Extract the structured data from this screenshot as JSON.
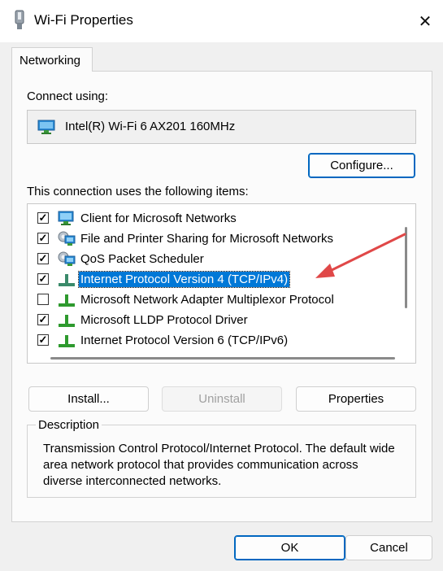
{
  "window": {
    "title": "Wi-Fi Properties",
    "close_glyph": "✕"
  },
  "tabs": [
    {
      "label": "Networking",
      "active": true
    }
  ],
  "connect_using": {
    "label": "Connect using:",
    "adapter": "Intel(R) Wi-Fi 6 AX201 160MHz",
    "configure_label": "Configure..."
  },
  "items_section": {
    "label": "This connection uses the following items:",
    "items": [
      {
        "label": "Client for Microsoft Networks",
        "checked": true,
        "icon": "network-client-icon",
        "selected": false
      },
      {
        "label": "File and Printer Sharing for Microsoft Networks",
        "checked": true,
        "icon": "service-icon",
        "selected": false
      },
      {
        "label": "QoS Packet Scheduler",
        "checked": true,
        "icon": "service-icon",
        "selected": false
      },
      {
        "label": "Internet Protocol Version 4 (TCP/IPv4)",
        "checked": true,
        "icon": "protocol-icon",
        "selected": true
      },
      {
        "label": "Microsoft Network Adapter Multiplexor Protocol",
        "checked": false,
        "icon": "protocol-icon",
        "selected": false
      },
      {
        "label": "Microsoft LLDP Protocol Driver",
        "checked": true,
        "icon": "protocol-icon",
        "selected": false
      },
      {
        "label": "Internet Protocol Version 6 (TCP/IPv6)",
        "checked": true,
        "icon": "protocol-icon",
        "selected": false
      }
    ]
  },
  "actions": {
    "install_label": "Install...",
    "uninstall_label": "Uninstall",
    "properties_label": "Properties"
  },
  "description": {
    "title": "Description",
    "text": "Transmission Control Protocol/Internet Protocol. The default wide area network protocol that provides communication across diverse interconnected networks."
  },
  "footer": {
    "ok_label": "OK",
    "cancel_label": "Cancel"
  },
  "colors": {
    "selection": "#0078d7",
    "accent_border": "#0067c0",
    "arrow": "#e04848"
  }
}
